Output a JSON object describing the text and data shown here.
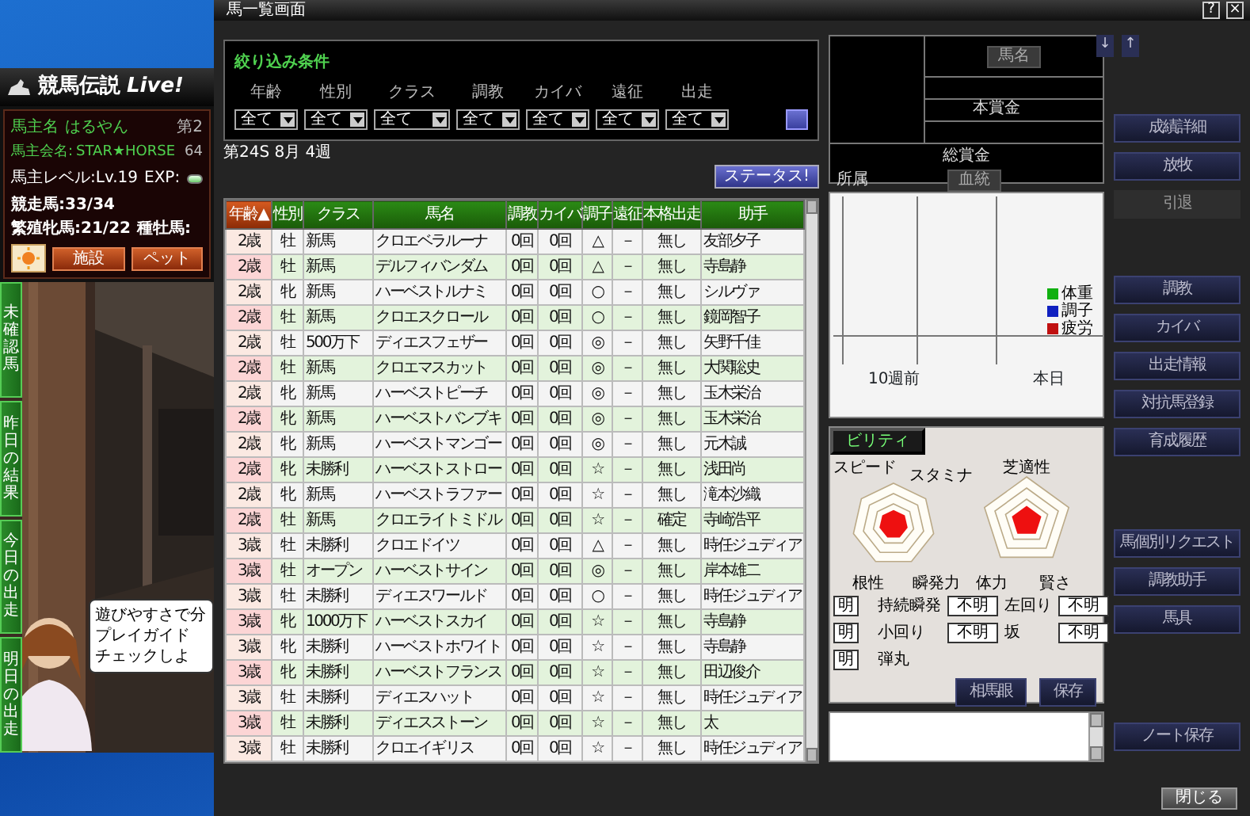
{
  "game_window": {
    "title": "競馬伝説",
    "title_italic": "Live!",
    "owner_label": "馬主名",
    "owner": "はるやん",
    "owner_extra": "第2",
    "club_label": "馬主会名:",
    "club": "STAR★HORSE",
    "club_extra": "64",
    "level": "馬主レベル:Lv.19",
    "exp_label": "EXP:",
    "exp": {
      "level": 0.95
    },
    "counts": [
      "競走馬:33/34",
      "繁殖牝馬:21/22",
      "種牡馬:"
    ],
    "buttons": [
      "施設",
      "ペット"
    ],
    "side_tabs": [
      "未確認馬",
      "昨日の結果",
      "今日の出走",
      "明日の出走"
    ],
    "speech_lines": [
      "遊びやすさで分",
      "プレイガイド",
      "チェックしよ"
    ]
  },
  "window": {
    "title": "馬一覧画面",
    "help": "?",
    "close": "×"
  },
  "filter": {
    "title": "絞り込み条件",
    "fields": [
      {
        "label": "年齢",
        "value": "全て"
      },
      {
        "label": "性別",
        "value": "全て"
      },
      {
        "label": "クラス",
        "value": "全て"
      },
      {
        "label": "調教",
        "value": "全て"
      },
      {
        "label": "カイバ",
        "value": "全て"
      },
      {
        "label": "遠征",
        "value": "全て"
      },
      {
        "label": "出走",
        "value": "全て"
      }
    ]
  },
  "date": "第24S 8月 4週",
  "status_button": "ステータス!",
  "table": {
    "columns": [
      {
        "label": "年齢",
        "sorted": true,
        "sort_mark": "▲"
      },
      {
        "label": "性別",
        "sorted": false
      },
      {
        "label": "クラス",
        "sorted": false
      },
      {
        "label": "馬名",
        "sorted": false
      },
      {
        "label": "調教",
        "sorted": false
      },
      {
        "label": "カイバ",
        "sorted": false
      },
      {
        "label": "調子",
        "sorted": false
      },
      {
        "label": "遠征",
        "sorted": false
      },
      {
        "label": "本格出走",
        "sorted": false
      },
      {
        "label": "助手",
        "sorted": false
      }
    ],
    "rows": [
      [
        "2歳",
        "牡",
        "新馬",
        "クロエベラルーナ",
        "0回",
        "0回",
        "△",
        "－",
        "無し",
        "友部夕子"
      ],
      [
        "2歳",
        "牡",
        "新馬",
        "デルフィバンダム",
        "0回",
        "0回",
        "△",
        "－",
        "無し",
        "寺島静"
      ],
      [
        "2歳",
        "牝",
        "新馬",
        "ハーベストルナミ",
        "0回",
        "0回",
        "○",
        "－",
        "無し",
        "シルヴァ"
      ],
      [
        "2歳",
        "牡",
        "新馬",
        "クロエスクロール",
        "0回",
        "0回",
        "○",
        "－",
        "無し",
        "鏡岡智子"
      ],
      [
        "2歳",
        "牡",
        "500万下",
        "ディエスフェザー",
        "0回",
        "0回",
        "◎",
        "－",
        "無し",
        "矢野千佳"
      ],
      [
        "2歳",
        "牡",
        "新馬",
        "クロエマスカット",
        "0回",
        "0回",
        "◎",
        "－",
        "無し",
        "大関聡史"
      ],
      [
        "2歳",
        "牝",
        "新馬",
        "ハーベストピーチ",
        "0回",
        "0回",
        "◎",
        "－",
        "無し",
        "玉木栄治"
      ],
      [
        "2歳",
        "牝",
        "新馬",
        "ハーベストバンブキ",
        "0回",
        "0回",
        "◎",
        "－",
        "無し",
        "玉木栄治"
      ],
      [
        "2歳",
        "牝",
        "新馬",
        "ハーベストマンゴー",
        "0回",
        "0回",
        "◎",
        "－",
        "無し",
        "元木誠"
      ],
      [
        "2歳",
        "牝",
        "未勝利",
        "ハーベストストロー",
        "0回",
        "0回",
        "☆",
        "－",
        "無し",
        "浅田尚"
      ],
      [
        "2歳",
        "牝",
        "新馬",
        "ハーベストラファー",
        "0回",
        "0回",
        "☆",
        "－",
        "無し",
        "滝本沙織"
      ],
      [
        "2歳",
        "牡",
        "新馬",
        "クロエライトミドル",
        "0回",
        "0回",
        "☆",
        "－",
        "確定",
        "寺崎浩平"
      ],
      [
        "3歳",
        "牡",
        "未勝利",
        "クロエドイツ",
        "0回",
        "0回",
        "△",
        "－",
        "無し",
        "時任ジュディア"
      ],
      [
        "3歳",
        "牡",
        "オープン",
        "ハーベストサイン",
        "0回",
        "0回",
        "◎",
        "－",
        "無し",
        "岸本雄二"
      ],
      [
        "3歳",
        "牡",
        "未勝利",
        "ディエスワールド",
        "0回",
        "0回",
        "○",
        "－",
        "無し",
        "時任ジュディア"
      ],
      [
        "3歳",
        "牝",
        "1000万下",
        "ハーベストスカイ",
        "0回",
        "0回",
        "☆",
        "－",
        "無し",
        "寺島静"
      ],
      [
        "3歳",
        "牝",
        "未勝利",
        "ハーベストホワイト",
        "0回",
        "0回",
        "☆",
        "－",
        "無し",
        "寺島静"
      ],
      [
        "3歳",
        "牝",
        "未勝利",
        "ハーベストフランス",
        "0回",
        "0回",
        "☆",
        "－",
        "無し",
        "田辺俊介"
      ],
      [
        "3歳",
        "牡",
        "未勝利",
        "ディエスハット",
        "0回",
        "0回",
        "☆",
        "－",
        "無し",
        "時任ジュディア"
      ],
      [
        "3歳",
        "牡",
        "未勝利",
        "ディエスストーン",
        "0回",
        "0回",
        "☆",
        "－",
        "無し",
        "太"
      ],
      [
        "3歳",
        "牡",
        "未勝利",
        "クロエイギリス",
        "0回",
        "0回",
        "☆",
        "－",
        "無し",
        "時任ジュディア"
      ]
    ]
  },
  "info_panel": {
    "name_button": "馬名",
    "prize": "本賞金",
    "total_prize": "総賞金",
    "owner_label": "所属",
    "pedigree_button": "血統",
    "arrows": [
      "↓",
      "↑"
    ]
  },
  "graph": {
    "legend": [
      {
        "label": "体重",
        "color": "#10b010"
      },
      {
        "label": "調子",
        "color": "#1020c0"
      },
      {
        "label": "疲労",
        "color": "#c01010"
      }
    ],
    "x_labels": [
      "10週前",
      "本日"
    ]
  },
  "ability": {
    "tab": "ビリティ",
    "radars": [
      {
        "kind": "heptagon",
        "labels": [
          "スピード",
          "スタミナ",
          "根性",
          "瞬発力"
        ]
      },
      {
        "kind": "pentagon",
        "labels": [
          "芝適性",
          "体力",
          "賢さ"
        ]
      }
    ],
    "fields": [
      {
        "value": "明"
      },
      {
        "label": "持続瞬発",
        "value": "不明"
      },
      {
        "label": "左回り",
        "value": "不明"
      },
      {
        "value": "明"
      },
      {
        "label": "小回り",
        "value": "不明"
      },
      {
        "label": "坂",
        "value": "不明"
      },
      {
        "value": "明"
      },
      {
        "label": "弾丸"
      }
    ],
    "buttons": [
      "相馬眼",
      "保存"
    ]
  },
  "side_button_groups": [
    [
      {
        "label": "成績詳細",
        "disabled": false
      },
      {
        "label": "放牧",
        "disabled": false
      },
      {
        "label": "引退",
        "disabled": true
      }
    ],
    [
      {
        "label": "調教",
        "disabled": false
      },
      {
        "label": "カイバ",
        "disabled": false
      },
      {
        "label": "出走情報",
        "disabled": false
      },
      {
        "label": "対抗馬登録",
        "disabled": false
      },
      {
        "label": "育成履歴",
        "disabled": false
      }
    ],
    [
      {
        "label": "馬個別リクエスト",
        "disabled": false
      },
      {
        "label": "調教助手",
        "disabled": false
      },
      {
        "label": "馬具",
        "disabled": false
      }
    ],
    [
      {
        "label": "ノート保存",
        "disabled": false
      }
    ]
  ],
  "close_button": "閉じる"
}
